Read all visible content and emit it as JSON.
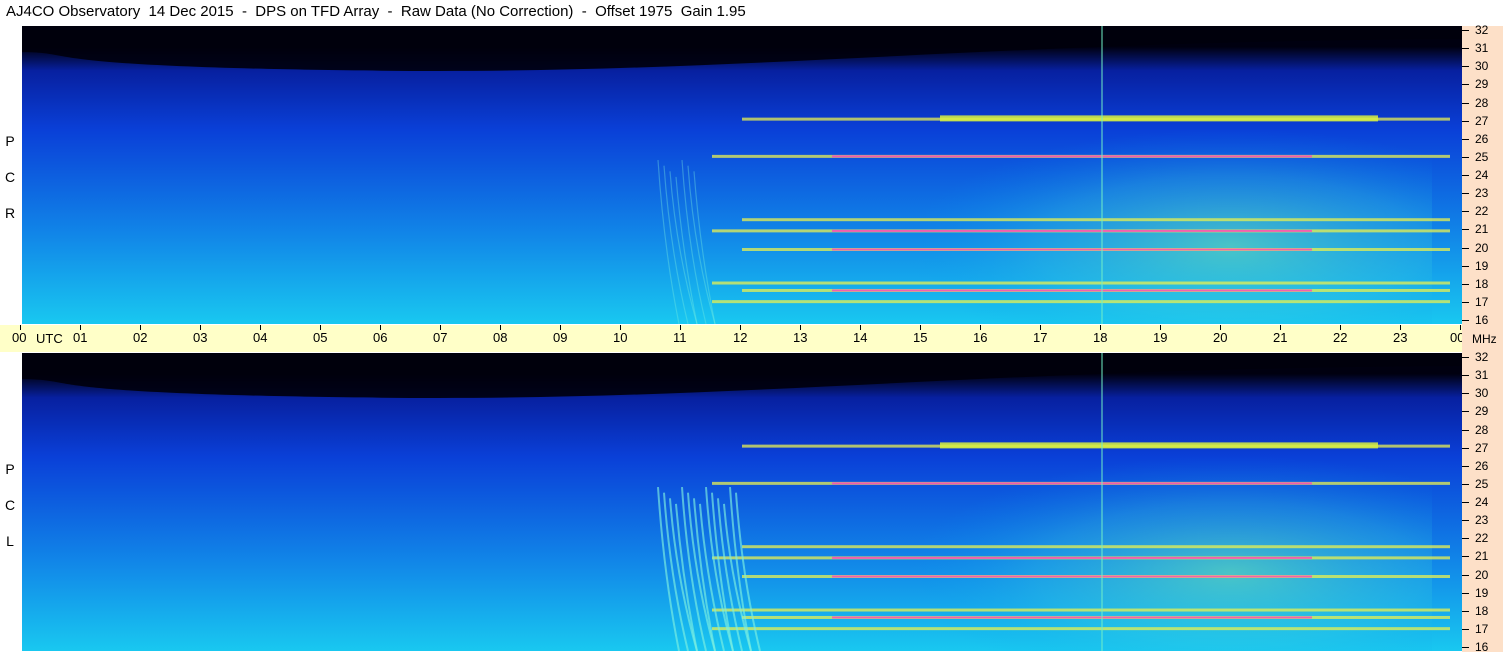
{
  "header": {
    "title": "AJ4CO Observatory  14 Dec 2015  -  DPS on TFD Array  -  Raw Data (No Correction)  -  Offset 1975  Gain 1.95"
  },
  "panels": [
    {
      "id": "rcp",
      "letters": [
        "P",
        "C",
        "R"
      ]
    },
    {
      "id": "lcp",
      "letters": [
        "P",
        "C",
        "L"
      ]
    }
  ],
  "time_axis": {
    "unit_label": "UTC",
    "ticks": [
      "00",
      "01",
      "02",
      "03",
      "04",
      "05",
      "06",
      "07",
      "08",
      "09",
      "10",
      "11",
      "12",
      "13",
      "14",
      "15",
      "16",
      "17",
      "18",
      "19",
      "20",
      "21",
      "22",
      "23",
      "00"
    ]
  },
  "freq_axis": {
    "unit_label": "MHz",
    "ticks": [
      "32",
      "31",
      "30",
      "29",
      "28",
      "27",
      "26",
      "25",
      "24",
      "23",
      "22",
      "21",
      "20",
      "19",
      "18",
      "17",
      "16"
    ]
  },
  "colors": {
    "time_bar": "#ffffc8",
    "freq_bar": "#fde0c8",
    "spectrogram_dark": "#000010",
    "spectrogram_blue": "#0a40d8",
    "spectrogram_cyan": "#19c8f0",
    "spectrogram_yellow": "#e8f050",
    "spectrogram_magenta": "#ff40c0"
  },
  "chart_data": {
    "type": "heatmap",
    "title": "AJ4CO Observatory  14 Dec 2015  -  DPS on TFD Array  -  Raw Data (No Correction)  -  Offset 1975  Gain 1.95",
    "x": {
      "label": "UTC",
      "range_hours": [
        0,
        24
      ],
      "ticks": [
        "00",
        "01",
        "02",
        "03",
        "04",
        "05",
        "06",
        "07",
        "08",
        "09",
        "10",
        "11",
        "12",
        "13",
        "14",
        "15",
        "16",
        "17",
        "18",
        "19",
        "20",
        "21",
        "22",
        "23",
        "00"
      ]
    },
    "y": {
      "label": "MHz",
      "range": [
        16,
        32
      ],
      "ticks": [
        16,
        17,
        18,
        19,
        20,
        21,
        22,
        23,
        24,
        25,
        26,
        27,
        28,
        29,
        30,
        31,
        32
      ]
    },
    "panels": [
      "R C P",
      "L C P"
    ],
    "interference_bands_mhz": [
      17.2,
      17.8,
      18.2,
      20.0,
      21.0,
      21.6,
      25.0,
      27.0
    ],
    "daytime_hours": [
      11,
      23
    ]
  }
}
